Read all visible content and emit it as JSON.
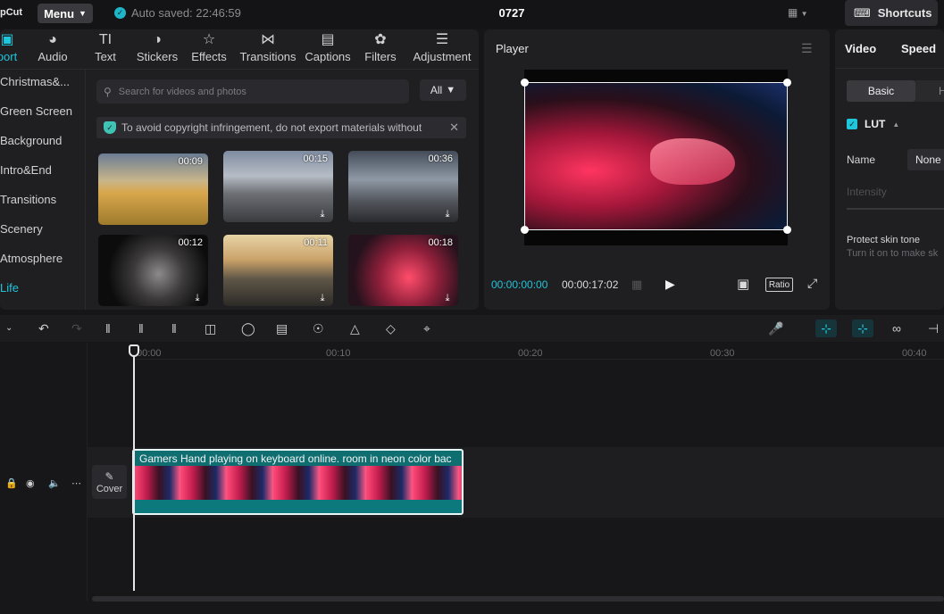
{
  "app": {
    "logo": "pCut",
    "menu_label": "Menu",
    "autosave_text": "Auto saved: 22:46:59",
    "project_title": "0727",
    "shortcuts_label": "Shortcuts"
  },
  "media_tabs": [
    {
      "label": "port",
      "icon": "import-icon"
    },
    {
      "label": "Audio",
      "icon": "audio-icon"
    },
    {
      "label": "Text",
      "icon": "text-icon"
    },
    {
      "label": "Stickers",
      "icon": "stickers-icon"
    },
    {
      "label": "Effects",
      "icon": "effects-icon"
    },
    {
      "label": "Transitions",
      "icon": "transitions-icon"
    },
    {
      "label": "Captions",
      "icon": "captions-icon"
    },
    {
      "label": "Filters",
      "icon": "filters-icon"
    },
    {
      "label": "Adjustment",
      "icon": "adjustment-icon"
    }
  ],
  "categories": [
    "Christmas&...",
    "Green Screen",
    "Background",
    "Intro&End",
    "Transitions",
    "Scenery",
    "Atmosphere",
    "Life"
  ],
  "search": {
    "placeholder": "Search for videos and photos",
    "filter_label": "All"
  },
  "notice": {
    "text": "To avoid copyright infringement, do not export materials without"
  },
  "thumbnails": [
    {
      "duration": "00:09"
    },
    {
      "duration": "00:15"
    },
    {
      "duration": "00:36"
    },
    {
      "duration": "00:12"
    },
    {
      "duration": "00:11"
    },
    {
      "duration": "00:18"
    }
  ],
  "player": {
    "title": "Player",
    "current_time": "00:00:00:00",
    "total_time": "00:00:17:02",
    "ratio_label": "Ratio"
  },
  "inspector": {
    "tabs": [
      "Video",
      "Speed"
    ],
    "basic_label": "Basic",
    "next_tab_partial": "H",
    "lut_label": "LUT",
    "name_label": "Name",
    "name_value": "None",
    "intensity_label": "Intensity",
    "protect_label": "Protect skin tone",
    "protect_sub": "Turn it on to make sk"
  },
  "timeline": {
    "ruler": [
      "00:00",
      "00:10",
      "00:20",
      "00:30",
      "00:40"
    ],
    "cover_label": "Cover",
    "clip_title": "Gamers Hand playing on keyboard online. room  in neon color bac"
  },
  "colors": {
    "accent": "#1fc6dc",
    "panel": "#1f1f22",
    "clip": "#0f6e70"
  }
}
